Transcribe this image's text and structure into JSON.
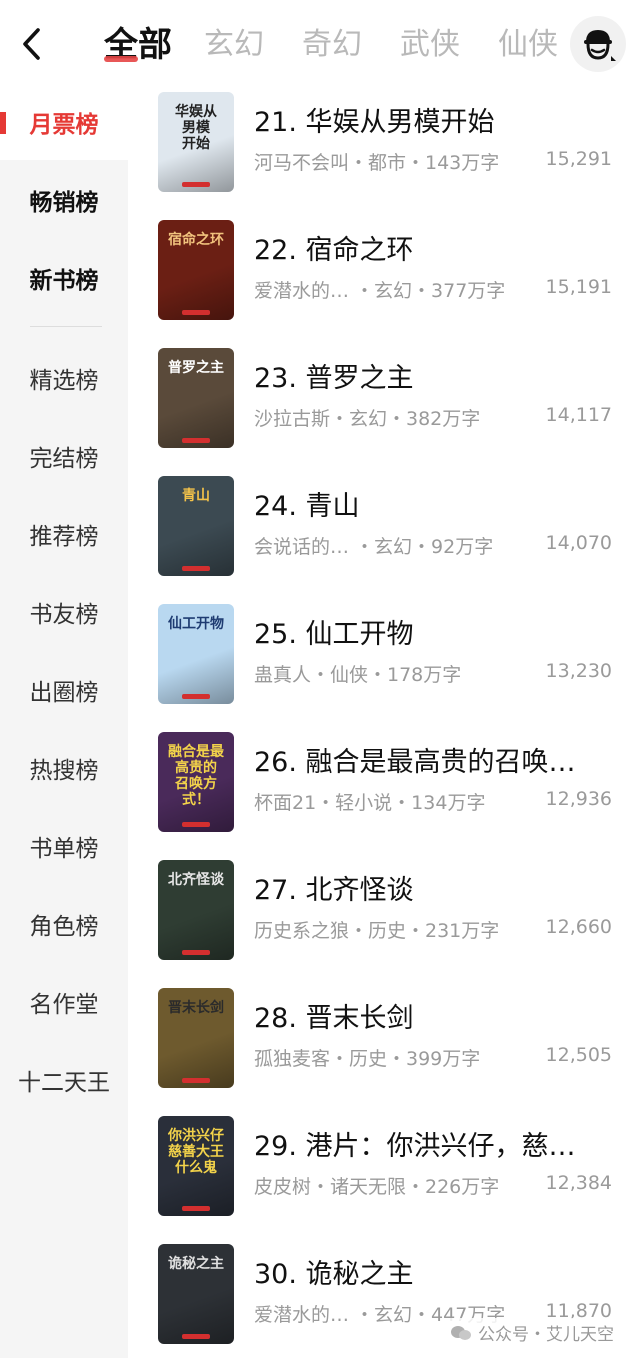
{
  "header": {
    "tabs": [
      {
        "label": "全部",
        "active": true
      },
      {
        "label": "玄幻",
        "active": false
      },
      {
        "label": "奇幻",
        "active": false
      },
      {
        "label": "武侠",
        "active": false
      },
      {
        "label": "仙侠",
        "active": false
      }
    ],
    "back_icon": "chevron-left-icon",
    "avatar_icon": "user-avatar-icon"
  },
  "sidebar": {
    "items": [
      {
        "label": "月票榜"
      },
      {
        "label": "畅销榜"
      },
      {
        "label": "新书榜"
      },
      {
        "label": "精选榜"
      },
      {
        "label": "完结榜"
      },
      {
        "label": "推荐榜"
      },
      {
        "label": "书友榜"
      },
      {
        "label": "出圈榜"
      },
      {
        "label": "热搜榜"
      },
      {
        "label": "书单榜"
      },
      {
        "label": "角色榜"
      },
      {
        "label": "名作堂"
      },
      {
        "label": "十二天王"
      }
    ],
    "accent": "#e53935"
  },
  "books": [
    {
      "title": "21. 华娱从男模开始",
      "meta": "河马不会叫・都市・143万字",
      "count": "15,291",
      "cover_text": "华娱从\n男模\n开始",
      "cover_bg": "#dfe7ee",
      "cover_fg": "#222222"
    },
    {
      "title": "22. 宿命之环",
      "meta": "爱潜水的…  ・玄幻・377万字",
      "count": "15,191",
      "cover_text": "宿命之环",
      "cover_bg": "#6b1f14",
      "cover_fg": "#f1c27d"
    },
    {
      "title": "23. 普罗之主",
      "meta": "沙拉古斯・玄幻・382万字",
      "count": "14,117",
      "cover_text": "普罗之主",
      "cover_bg": "#5a4a3a",
      "cover_fg": "#ffffff"
    },
    {
      "title": "24. 青山",
      "meta": "会说话的…  ・玄幻・92万字",
      "count": "14,070",
      "cover_text": "青山",
      "cover_bg": "#3c4a52",
      "cover_fg": "#f3c24a"
    },
    {
      "title": "25. 仙工开物",
      "meta": "蛊真人・仙侠・178万字",
      "count": "13,230",
      "cover_text": "仙工开物",
      "cover_bg": "#b9d8f0",
      "cover_fg": "#1f3c72"
    },
    {
      "title": "26. 融合是最高贵的召唤…",
      "meta": "杯面21・轻小说・134万字",
      "count": "12,936",
      "cover_text": "融合是最高贵的\n召唤方式！",
      "cover_bg": "#4a2a5a",
      "cover_fg": "#f3d34a"
    },
    {
      "title": "27. 北齐怪谈",
      "meta": "历史系之狼・历史・231万字",
      "count": "12,660",
      "cover_text": "北齐怪谈",
      "cover_bg": "#2f3d33",
      "cover_fg": "#e6e6e6"
    },
    {
      "title": "28. 晋末长剑",
      "meta": "孤独麦客・历史・399万字",
      "count": "12,505",
      "cover_text": "晋末长剑",
      "cover_bg": "#6e5a2e",
      "cover_fg": "#2b2b2b"
    },
    {
      "title": "29. 港片：你洪兴仔，慈…",
      "meta": "皮皮树・诸天无限・226万字",
      "count": "12,384",
      "cover_text": "你洪兴仔\n慈善大王什么鬼",
      "cover_bg": "#2a2f3a",
      "cover_fg": "#f3d34a"
    },
    {
      "title": "30. 诡秘之主",
      "meta": "爱潜水的…  ・玄幻・447万字",
      "count": "11,870",
      "cover_text": "诡秘之主",
      "cover_bg": "#2d3136",
      "cover_fg": "#e0e0e0"
    }
  ],
  "watermark": {
    "label": "公众号・艾儿天空",
    "icon": "wechat-icon"
  }
}
